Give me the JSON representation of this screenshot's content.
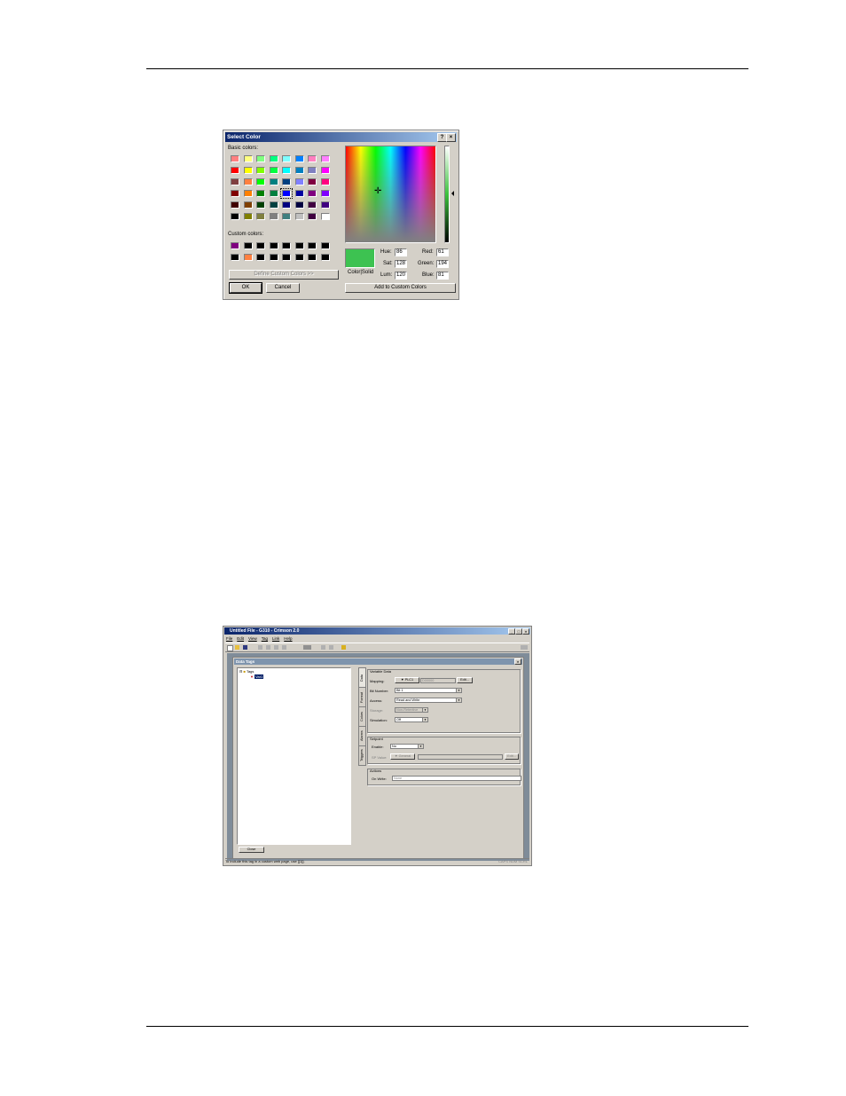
{
  "select_color": {
    "title": "Select Color",
    "help_glyph": "?",
    "close_glyph": "×",
    "basic_label": "Basic colors:",
    "custom_label": "Custom colors:",
    "basic_colors": [
      "#ff8080",
      "#ffff80",
      "#80ff80",
      "#00ff80",
      "#80ffff",
      "#0080ff",
      "#ff80c0",
      "#ff80ff",
      "#ff0000",
      "#ffff00",
      "#80ff00",
      "#00ff40",
      "#00ffff",
      "#0080c0",
      "#8080c0",
      "#ff00ff",
      "#804040",
      "#ff8040",
      "#00ff00",
      "#008080",
      "#004080",
      "#8080ff",
      "#800040",
      "#ff0080",
      "#800000",
      "#ff8000",
      "#008000",
      "#008040",
      "#0000ff",
      "#0000a0",
      "#800080",
      "#8000ff",
      "#400000",
      "#804000",
      "#004000",
      "#004040",
      "#000080",
      "#000040",
      "#400040",
      "#400080",
      "#000000",
      "#808000",
      "#808040",
      "#808080",
      "#408080",
      "#c0c0c0",
      "#400040",
      "#ffffff"
    ],
    "selected_basic_index": 28,
    "custom_colors": [
      "#800080",
      "#000000",
      "#000000",
      "#000000",
      "#000000",
      "#000000",
      "#000000",
      "#000000",
      "#000000",
      "#ff8040",
      "#000000",
      "#000000",
      "#000000",
      "#000000",
      "#000000",
      "#000000"
    ],
    "define_custom_label": "Define Custom Colors >>",
    "ok_label": "OK",
    "cancel_label": "Cancel",
    "color_solid_label": "Color|Solid",
    "hue_label": "Hue:",
    "sat_label": "Sat:",
    "lum_label": "Lum:",
    "red_label": "Red:",
    "green_label": "Green:",
    "blue_label": "Blue:",
    "hue": "86",
    "sat": "128",
    "lum": "120",
    "red": "61",
    "green": "194",
    "blue": "81",
    "current_color": "#3dc251",
    "add_custom_label": "Add to Custom Colors"
  },
  "crimson": {
    "title": "Untitled File - G310 - Crimson 2.0",
    "menu": [
      "File",
      "Edit",
      "View",
      "Tag",
      "Link",
      "Help"
    ],
    "child_title": "Data Tags",
    "tree_root": "Tags",
    "tree_child": "Var1",
    "vertical_tabs": [
      "Data",
      "Format",
      "Colors",
      "Alarms",
      "Triggers"
    ],
    "variable_group": "Variable Data",
    "mapping_label": "Mapping:",
    "mapping_value": "PLC1",
    "mapping_addr": "D00000",
    "edit_button": "Edit...",
    "bit_label": "Bit Number:",
    "bit_value": "Bit 1",
    "access_label": "Access:",
    "access_value": "Read and Write",
    "storage_label": "Storage:",
    "storage_value": "Non-Retentive",
    "simulation_label": "Simulation:",
    "simulation_value": "Off",
    "setpoint_group": "Setpoint",
    "enable_label": "Enable:",
    "enable_value": "No",
    "sp_value_label": "SP Value:",
    "sp_value_btn": "General",
    "sp_edit_btn": "Edit...",
    "actions_group": "Actions",
    "on_write_label": "On Write:",
    "on_write_value": "None",
    "close_button": "Close",
    "status": "To include this tag in a custom web page, use [[1]].",
    "status_right": "CAPS  NUM  SCRL"
  }
}
